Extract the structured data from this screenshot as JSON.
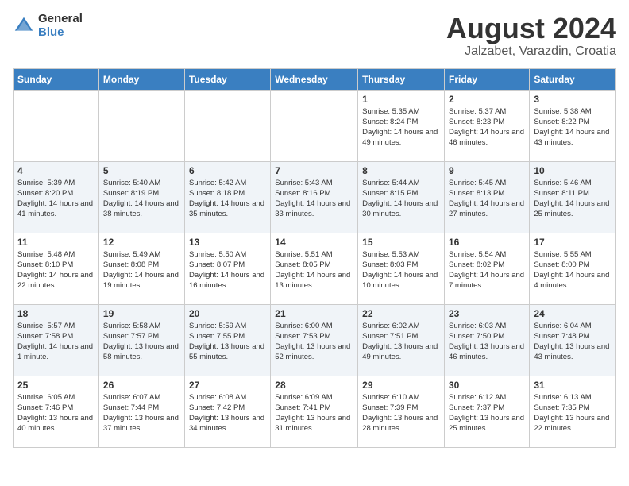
{
  "header": {
    "logo_general": "General",
    "logo_blue": "Blue",
    "month_year": "August 2024",
    "location": "Jalzabet, Varazdin, Croatia"
  },
  "days_of_week": [
    "Sunday",
    "Monday",
    "Tuesday",
    "Wednesday",
    "Thursday",
    "Friday",
    "Saturday"
  ],
  "weeks": [
    [
      {
        "day": "",
        "info": ""
      },
      {
        "day": "",
        "info": ""
      },
      {
        "day": "",
        "info": ""
      },
      {
        "day": "",
        "info": ""
      },
      {
        "day": "1",
        "info": "Sunrise: 5:35 AM\nSunset: 8:24 PM\nDaylight: 14 hours and 49 minutes."
      },
      {
        "day": "2",
        "info": "Sunrise: 5:37 AM\nSunset: 8:23 PM\nDaylight: 14 hours and 46 minutes."
      },
      {
        "day": "3",
        "info": "Sunrise: 5:38 AM\nSunset: 8:22 PM\nDaylight: 14 hours and 43 minutes."
      }
    ],
    [
      {
        "day": "4",
        "info": "Sunrise: 5:39 AM\nSunset: 8:20 PM\nDaylight: 14 hours and 41 minutes."
      },
      {
        "day": "5",
        "info": "Sunrise: 5:40 AM\nSunset: 8:19 PM\nDaylight: 14 hours and 38 minutes."
      },
      {
        "day": "6",
        "info": "Sunrise: 5:42 AM\nSunset: 8:18 PM\nDaylight: 14 hours and 35 minutes."
      },
      {
        "day": "7",
        "info": "Sunrise: 5:43 AM\nSunset: 8:16 PM\nDaylight: 14 hours and 33 minutes."
      },
      {
        "day": "8",
        "info": "Sunrise: 5:44 AM\nSunset: 8:15 PM\nDaylight: 14 hours and 30 minutes."
      },
      {
        "day": "9",
        "info": "Sunrise: 5:45 AM\nSunset: 8:13 PM\nDaylight: 14 hours and 27 minutes."
      },
      {
        "day": "10",
        "info": "Sunrise: 5:46 AM\nSunset: 8:11 PM\nDaylight: 14 hours and 25 minutes."
      }
    ],
    [
      {
        "day": "11",
        "info": "Sunrise: 5:48 AM\nSunset: 8:10 PM\nDaylight: 14 hours and 22 minutes."
      },
      {
        "day": "12",
        "info": "Sunrise: 5:49 AM\nSunset: 8:08 PM\nDaylight: 14 hours and 19 minutes."
      },
      {
        "day": "13",
        "info": "Sunrise: 5:50 AM\nSunset: 8:07 PM\nDaylight: 14 hours and 16 minutes."
      },
      {
        "day": "14",
        "info": "Sunrise: 5:51 AM\nSunset: 8:05 PM\nDaylight: 14 hours and 13 minutes."
      },
      {
        "day": "15",
        "info": "Sunrise: 5:53 AM\nSunset: 8:03 PM\nDaylight: 14 hours and 10 minutes."
      },
      {
        "day": "16",
        "info": "Sunrise: 5:54 AM\nSunset: 8:02 PM\nDaylight: 14 hours and 7 minutes."
      },
      {
        "day": "17",
        "info": "Sunrise: 5:55 AM\nSunset: 8:00 PM\nDaylight: 14 hours and 4 minutes."
      }
    ],
    [
      {
        "day": "18",
        "info": "Sunrise: 5:57 AM\nSunset: 7:58 PM\nDaylight: 14 hours and 1 minute."
      },
      {
        "day": "19",
        "info": "Sunrise: 5:58 AM\nSunset: 7:57 PM\nDaylight: 13 hours and 58 minutes."
      },
      {
        "day": "20",
        "info": "Sunrise: 5:59 AM\nSunset: 7:55 PM\nDaylight: 13 hours and 55 minutes."
      },
      {
        "day": "21",
        "info": "Sunrise: 6:00 AM\nSunset: 7:53 PM\nDaylight: 13 hours and 52 minutes."
      },
      {
        "day": "22",
        "info": "Sunrise: 6:02 AM\nSunset: 7:51 PM\nDaylight: 13 hours and 49 minutes."
      },
      {
        "day": "23",
        "info": "Sunrise: 6:03 AM\nSunset: 7:50 PM\nDaylight: 13 hours and 46 minutes."
      },
      {
        "day": "24",
        "info": "Sunrise: 6:04 AM\nSunset: 7:48 PM\nDaylight: 13 hours and 43 minutes."
      }
    ],
    [
      {
        "day": "25",
        "info": "Sunrise: 6:05 AM\nSunset: 7:46 PM\nDaylight: 13 hours and 40 minutes."
      },
      {
        "day": "26",
        "info": "Sunrise: 6:07 AM\nSunset: 7:44 PM\nDaylight: 13 hours and 37 minutes."
      },
      {
        "day": "27",
        "info": "Sunrise: 6:08 AM\nSunset: 7:42 PM\nDaylight: 13 hours and 34 minutes."
      },
      {
        "day": "28",
        "info": "Sunrise: 6:09 AM\nSunset: 7:41 PM\nDaylight: 13 hours and 31 minutes."
      },
      {
        "day": "29",
        "info": "Sunrise: 6:10 AM\nSunset: 7:39 PM\nDaylight: 13 hours and 28 minutes."
      },
      {
        "day": "30",
        "info": "Sunrise: 6:12 AM\nSunset: 7:37 PM\nDaylight: 13 hours and 25 minutes."
      },
      {
        "day": "31",
        "info": "Sunrise: 6:13 AM\nSunset: 7:35 PM\nDaylight: 13 hours and 22 minutes."
      }
    ]
  ]
}
